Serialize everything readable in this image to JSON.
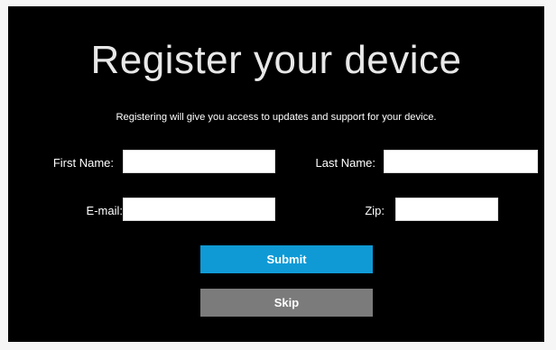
{
  "title": "Register your device",
  "subtitle": "Registering will give you access to updates and support for your device.",
  "form": {
    "first_name": {
      "label": "First Name:",
      "value": ""
    },
    "last_name": {
      "label": "Last Name:",
      "value": ""
    },
    "email": {
      "label": "E-mail:",
      "value": ""
    },
    "zip": {
      "label": "Zip:",
      "value": ""
    }
  },
  "buttons": {
    "submit_label": "Submit",
    "skip_label": "Skip"
  },
  "colors": {
    "background": "#000000",
    "submit": "#0f9ad6",
    "skip": "#7b7b7b"
  }
}
